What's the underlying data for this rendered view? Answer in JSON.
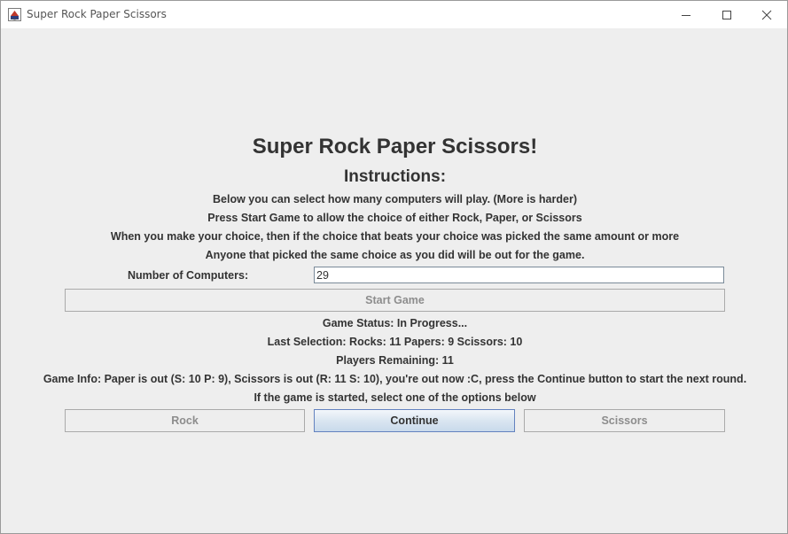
{
  "window": {
    "title": "Super Rock Paper Scissors",
    "icon": "java-cup-icon",
    "controls": {
      "minimize": "minimize-icon",
      "maximize": "maximize-icon",
      "close": "close-icon"
    }
  },
  "header": {
    "title": "Super Rock Paper Scissors!",
    "instructions_title": "Instructions:",
    "instructions": [
      "Below you can select how many computers will play. (More is harder)",
      "Press Start Game to allow the choice of either Rock, Paper, or Scissors",
      "When you make your choice, then if the choice that beats your choice was picked the same amount or more",
      "Anyone that picked the same choice as you did will be out for the game."
    ]
  },
  "setup": {
    "num_computers_label": "Number of Computers:",
    "num_computers_value": "29",
    "start_button_label": "Start Game",
    "start_button_enabled": false
  },
  "status": {
    "game_status": "Game Status: In Progress...",
    "last_selection": "Last Selection: Rocks: 11 Papers: 9 Scissors: 10",
    "players_remaining": "Players Remaining: 11",
    "game_info": "Game Info: Paper is out (S: 10 P: 9), Scissors is out (R: 11 S: 10),  you're out now :C, press the Continue button to start the next round.",
    "prompt": "If the game is started, select one of the options below"
  },
  "choices": {
    "rock_label": "Rock",
    "rock_enabled": false,
    "continue_label": "Continue",
    "continue_enabled": true,
    "scissors_label": "Scissors",
    "scissors_enabled": false
  },
  "colors": {
    "background": "#eeeeee",
    "text": "#333333",
    "disabled_text": "#8d8d8d",
    "continue_border": "#6382bf"
  }
}
